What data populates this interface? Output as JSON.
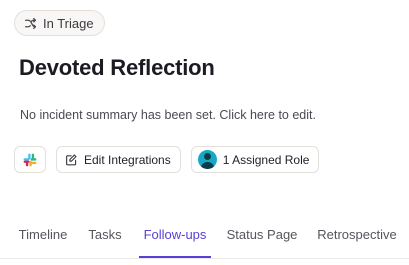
{
  "status": {
    "label": "In Triage",
    "icon": "shuffle-icon"
  },
  "incident": {
    "title": "Devoted Reflection",
    "summary": "No incident summary has been set. Click here to edit."
  },
  "actions": {
    "slack_icon": "slack-icon",
    "edit_integrations_label": "Edit Integrations",
    "edit_icon": "edit-icon",
    "assigned_roles_label": "1 Assigned Role",
    "avatar_icon": "user-avatar-icon"
  },
  "tabs": [
    {
      "label": "Timeline",
      "active": false
    },
    {
      "label": "Tasks",
      "active": false
    },
    {
      "label": "Follow-ups",
      "active": true
    },
    {
      "label": "Status Page",
      "active": false
    },
    {
      "label": "Retrospective",
      "active": false
    }
  ],
  "colors": {
    "accent": "#5b3fd6",
    "avatar": "#17a8c5",
    "slack_red": "#e01e5a",
    "slack_green": "#2eb67d",
    "slack_blue": "#36c5f0",
    "slack_yellow": "#ecb22e"
  }
}
